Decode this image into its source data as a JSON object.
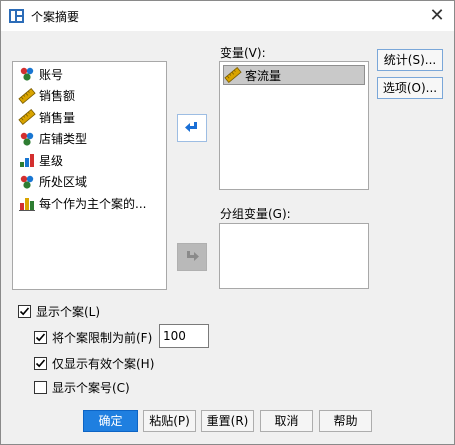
{
  "window": {
    "title": "个案摘要",
    "close_glyph": "✕"
  },
  "source_vars": [
    {
      "label": "账号",
      "icon": "nominal-icon"
    },
    {
      "label": "销售额",
      "icon": "scale-icon"
    },
    {
      "label": "销售量",
      "icon": "scale-icon"
    },
    {
      "label": "店铺类型",
      "icon": "nominal-icon"
    },
    {
      "label": "星级",
      "icon": "ordinal-icon"
    },
    {
      "label": "所处区域",
      "icon": "nominal-icon"
    },
    {
      "label": "每个作为主个案的...",
      "icon": "bar-chart-icon"
    }
  ],
  "variables": {
    "label": "变量(V):",
    "items": [
      {
        "label": "客流量",
        "icon": "scale-icon"
      }
    ]
  },
  "grouping": {
    "label": "分组变量(G):"
  },
  "side_buttons": {
    "stats": "统计(S)...",
    "options": "选项(O)..."
  },
  "checkboxes": {
    "show_cases": {
      "label": "显示个案(L)",
      "checked": true
    },
    "limit_cases": {
      "label": "将个案限制为前(F)",
      "checked": true,
      "value": "100"
    },
    "valid_only": {
      "label": "仅显示有效个案(H)",
      "checked": true
    },
    "case_numbers": {
      "label": "显示个案号(C)",
      "checked": false
    }
  },
  "buttons": {
    "ok": "确定",
    "paste": "粘贴(P)",
    "reset": "重置(R)",
    "cancel": "取消",
    "help": "帮助"
  },
  "colors": {
    "accent": "#1f7fe0",
    "ruler": "#d9a400",
    "arrow": "#1a6fd6"
  }
}
